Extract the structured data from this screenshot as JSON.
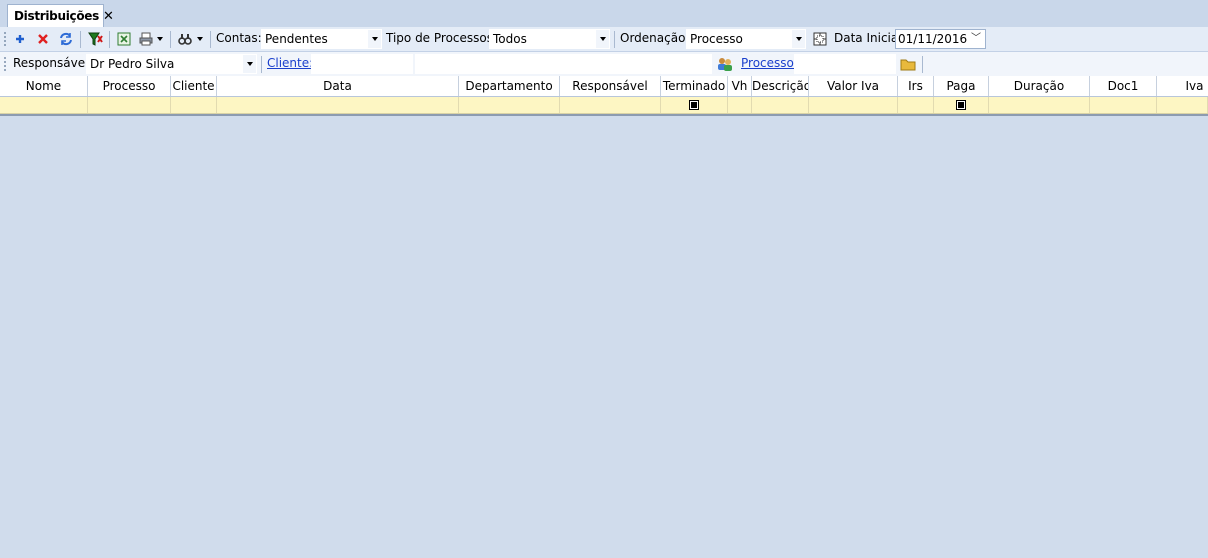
{
  "tab": {
    "title": "Distribuições",
    "close": "✕"
  },
  "toolbar": {
    "icons": [
      "add-icon",
      "delete-icon",
      "refresh-icon",
      "filter-icon",
      "excel-icon",
      "print-icon",
      "find-icon"
    ],
    "contas_label": "Contas:",
    "contas_value": "Pendentes",
    "tipo_label": "Tipo de Processos:",
    "tipo_value": "Todos",
    "ordenacao_label": "Ordenação:",
    "ordenacao_value": "Processo",
    "data_label": "Data Inicial",
    "data_value": "01/11/2016"
  },
  "filters": {
    "responsavel_label": "Responsável:",
    "responsavel_value": "Dr Pedro Silva",
    "cliente_link": "Cliente:",
    "processo_link": "Processo:"
  },
  "grid": {
    "columns": [
      "Nome",
      "Processo",
      "Cliente",
      "Data",
      "Departamento",
      "Responsável",
      "Terminado",
      "Vh",
      "Descrição",
      "Valor Iva",
      "Irs",
      "Paga",
      "Duração",
      "Doc1",
      "Iva"
    ]
  },
  "colors": {
    "background": "#d0dcec",
    "toolbar": "#e4ecf7",
    "filter_row": "#fdf6c3",
    "link": "#1a3fcc"
  }
}
